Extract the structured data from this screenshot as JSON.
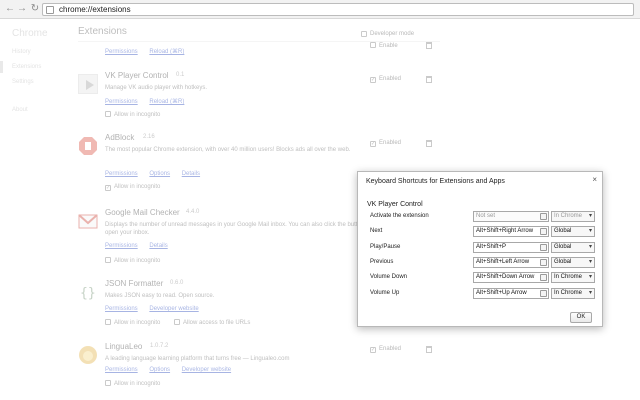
{
  "toolbar": {
    "back": "←",
    "forward": "→",
    "reload": "↻",
    "url": "chrome://extensions"
  },
  "sidebar": {
    "title": "Chrome",
    "items": [
      "History",
      "Extensions",
      "Settings",
      "About"
    ]
  },
  "page": {
    "title": "Extensions",
    "developer_mode": "Developer mode",
    "enable_label": "Enable",
    "enabled_label": "Enabled",
    "permissions": "Permissions",
    "reload": "Reload (⌘R)",
    "options": "Options",
    "details": "Details",
    "developer_website": "Developer website",
    "allow_incognito": "Allow in incognito",
    "allow_file_urls": "Allow access to file URLs",
    "extensions": [
      {
        "name": "VK Player Control",
        "version": "0.1",
        "description": "Manage VK audio player with hotkeys."
      },
      {
        "name": "AdBlock",
        "version": "2.16",
        "description": "The most popular Chrome extension, with over 40 million users! Blocks ads all over the web."
      },
      {
        "name": "Google Mail Checker",
        "version": "4.4.0",
        "description": "Displays the number of unread messages in your Google Mail inbox. You can also click the button to open your inbox."
      },
      {
        "name": "JSON Formatter",
        "version": "0.6.0",
        "description": "Makes JSON easy to read. Open source."
      },
      {
        "name": "LinguaLeo",
        "version": "1.0.7.2",
        "description": "A leading language learning platform that turns free — Lingualeo.com"
      }
    ]
  },
  "dialog": {
    "title": "Keyboard Shortcuts for Extensions and Apps",
    "close": "×",
    "section": "VK Player Control",
    "ok": "OK",
    "shortcuts": [
      {
        "label": "Activate the extension",
        "value": "Not set",
        "scope": "In Chrome"
      },
      {
        "label": "Next",
        "value": "Alt+Shift+Right Arrow",
        "scope": "Global"
      },
      {
        "label": "Play/Pause",
        "value": "Alt+Shift+P",
        "scope": "Global"
      },
      {
        "label": "Previous",
        "value": "Alt+Shift+Left Arrow",
        "scope": "Global"
      },
      {
        "label": "Volume Down",
        "value": "Alt+Shift+Down Arrow",
        "scope": "In Chrome"
      },
      {
        "label": "Volume Up",
        "value": "Alt+Shift+Up Arrow",
        "scope": "In Chrome"
      }
    ],
    "dropdown_arrow": "▾"
  }
}
